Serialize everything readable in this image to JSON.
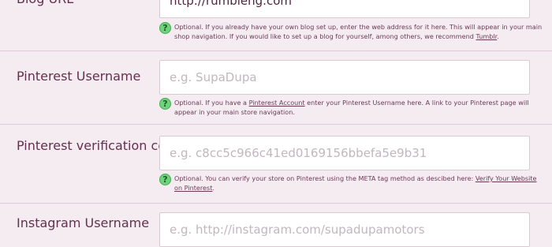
{
  "blog_url": {
    "label": "Blog URL",
    "value": "http://rumbleng.com",
    "help_before": "Optional. If you already have your own blog set up, enter the web address for it here. This will appear in your main shop navigation. If you would like to set up a blog for yourself, among others, we recommend ",
    "help_link": "Tumblr",
    "help_after": "."
  },
  "pinterest_username": {
    "label": "Pinterest Username",
    "placeholder": "e.g. SupaDupa",
    "help_before": "Optional. If you have a ",
    "help_link": "Pinterest Account",
    "help_after": " enter your Pinterest Username here. A link to your Pinterest page will appear in your main store navigation."
  },
  "pinterest_verification": {
    "label": "Pinterest verification code",
    "placeholder": "e.g. c8cc5c966c41ed0169156bbefa5e9b31",
    "help_before": "Optional. You can verify your store on Pinterest using the META tag method as descibed here: ",
    "help_link": "Verify Your Website on Pinterest",
    "help_after": "."
  },
  "instagram_username": {
    "label": "Instagram Username",
    "placeholder": "e.g. http://instagram.com/supadupamotors"
  },
  "help_icon_glyph": "?",
  "colors": {
    "page_background": "#f4ecf0",
    "label_text": "#63304f",
    "help_icon": "#6fd37c"
  }
}
